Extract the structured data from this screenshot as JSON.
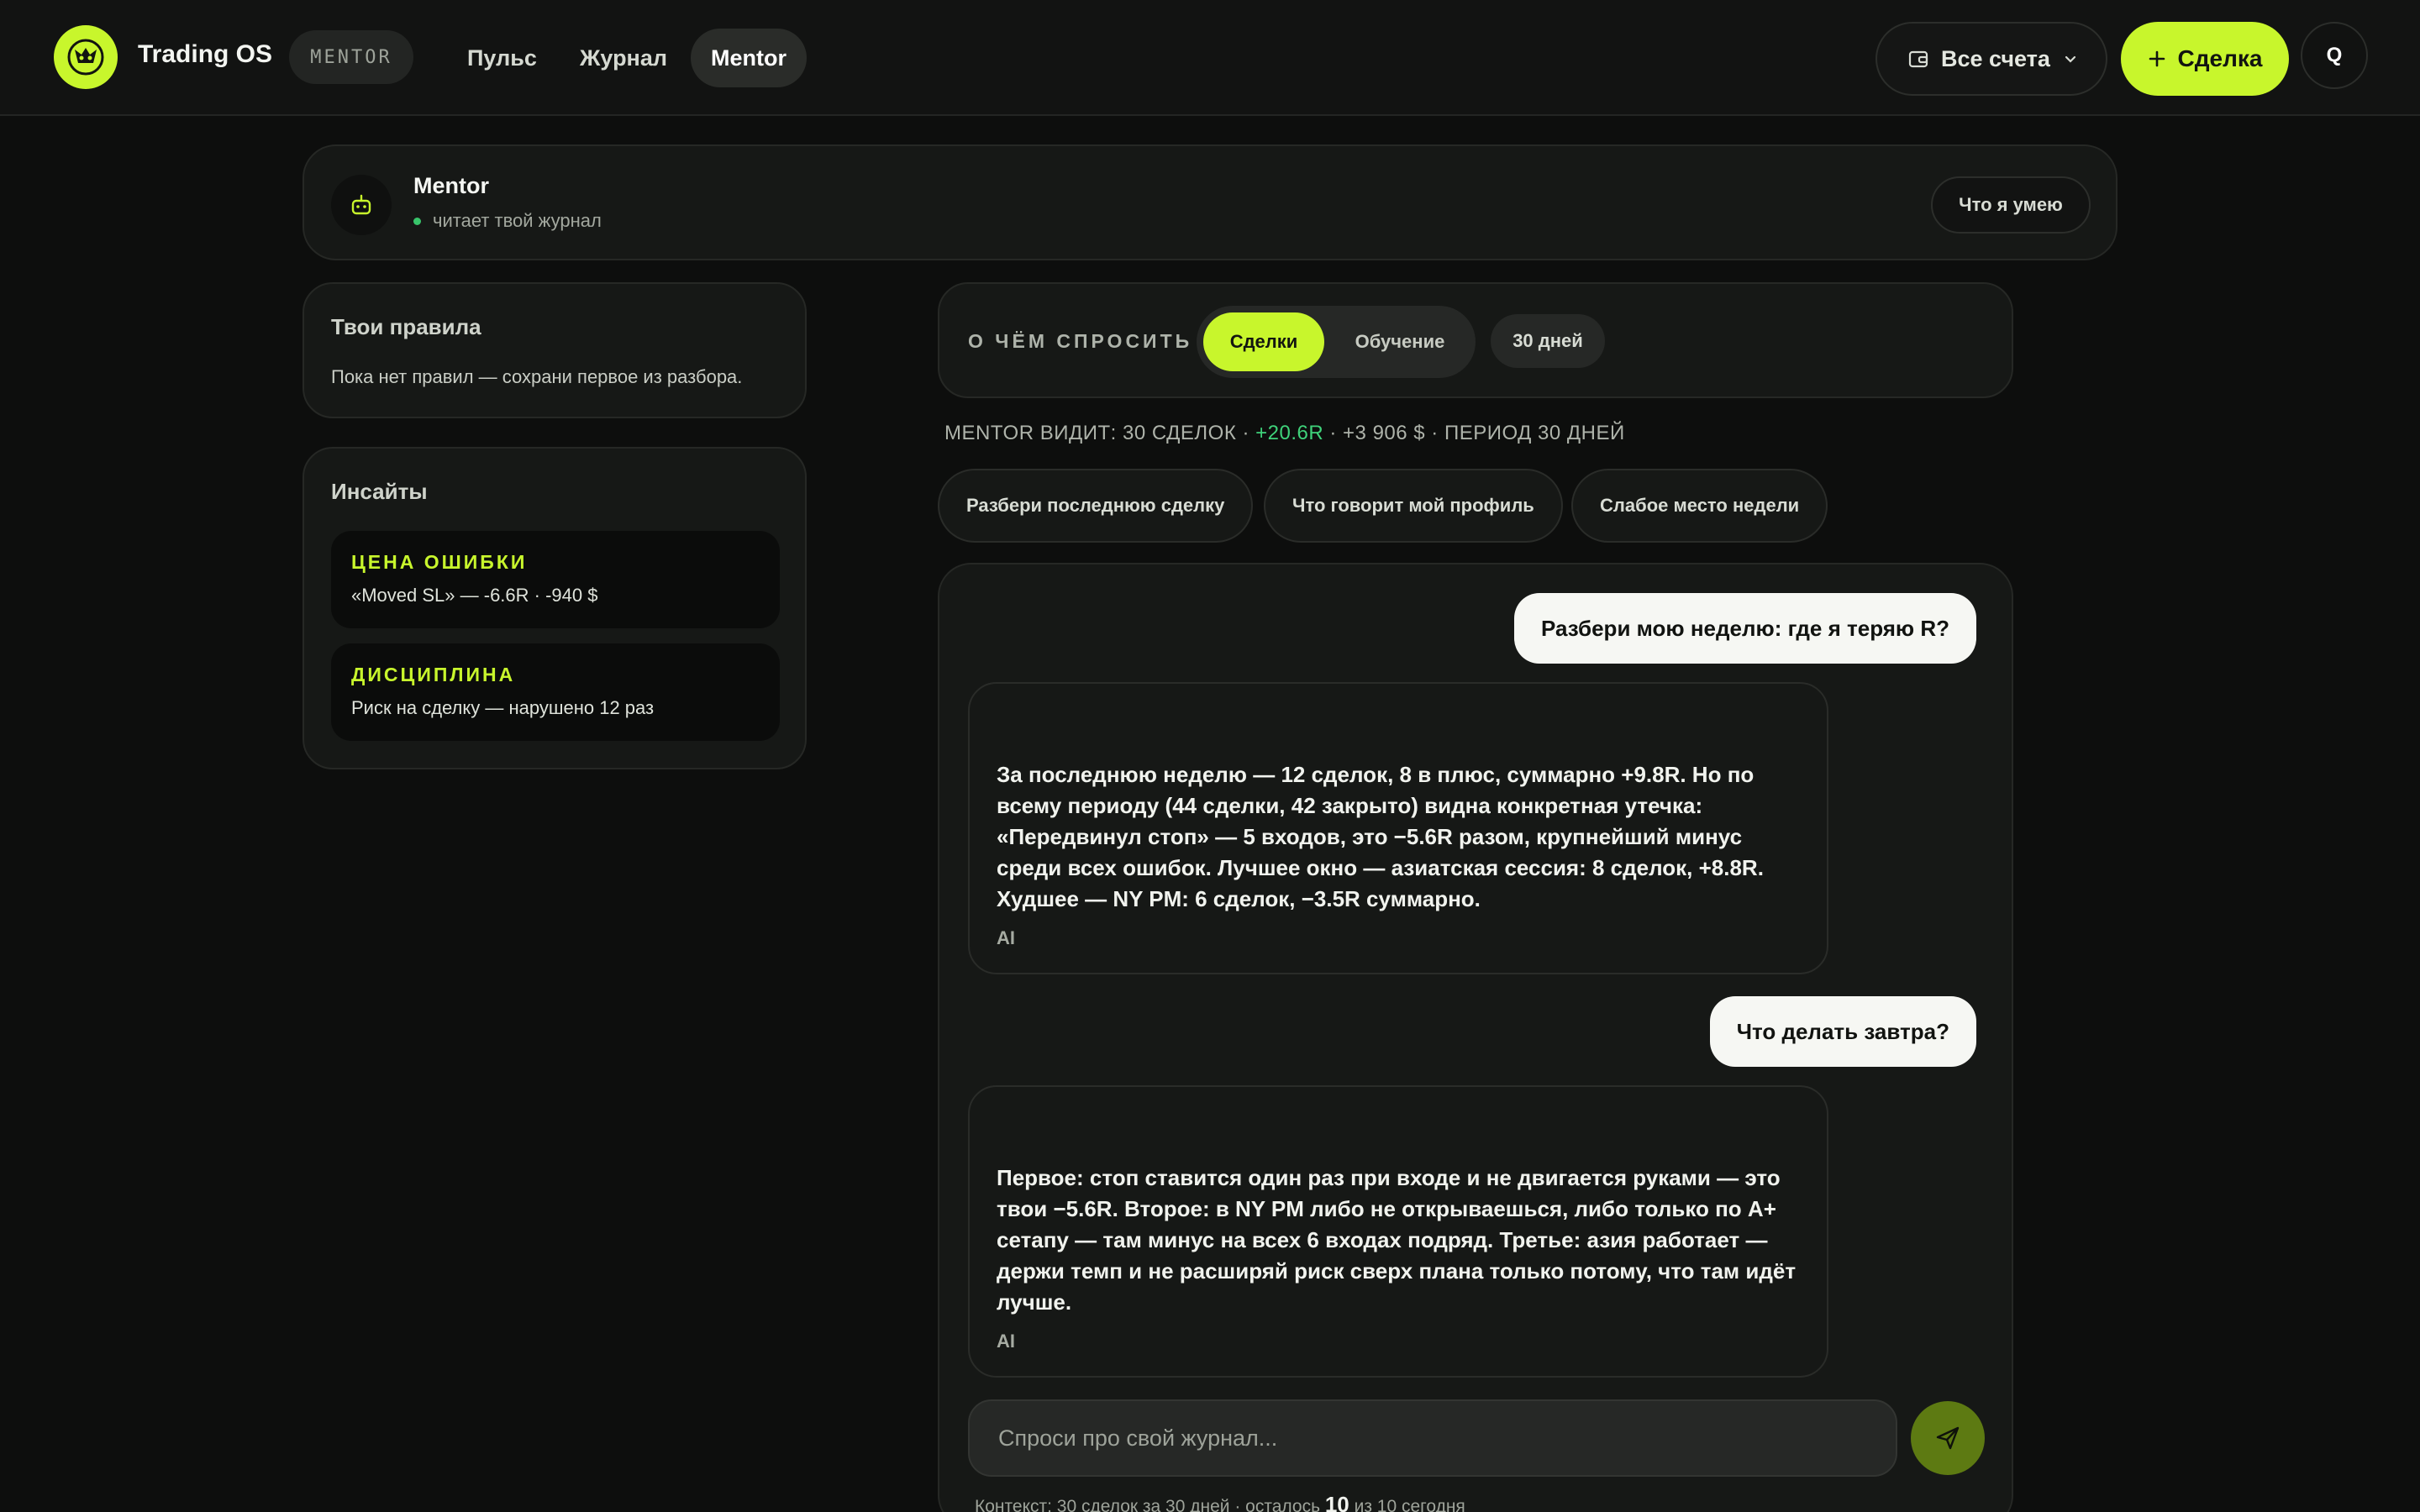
{
  "header": {
    "brand": "Trading OS",
    "mode_badge": "MENTOR",
    "nav": [
      {
        "label": "Пульс",
        "active": false
      },
      {
        "label": "Журнал",
        "active": false
      },
      {
        "label": "Mentor",
        "active": true
      }
    ],
    "accounts_label": "Все счета",
    "deal_button": "Сделка",
    "search_label": "Q"
  },
  "mentor": {
    "name": "Mentor",
    "status": "читает твой журнал",
    "capabilities_button": "Что я умею"
  },
  "rules": {
    "title": "Твои правила",
    "empty_text": "Пока нет правил — сохрани первое из разбора."
  },
  "insights": {
    "title": "Инсайты",
    "items": [
      {
        "heading": "ЦЕНА ОШИБКИ",
        "text": "«Moved SL» — -6.6R · -940 $"
      },
      {
        "heading": "ДИСЦИПЛИНА",
        "text": "Риск на сделку — нарушено 12 раз"
      }
    ]
  },
  "ask": {
    "label": "О ЧЁМ СПРОСИТЬ",
    "tabs": [
      {
        "label": "Сделки",
        "active": true
      },
      {
        "label": "Обучение",
        "active": false
      }
    ],
    "period": "30 дней"
  },
  "summary": {
    "prefix": "MENTOR ВИДИТ: 30 СДЕЛОК · ",
    "r_value": "+20.6R",
    "suffix": " · +3 906 $ · ПЕРИОД 30 ДНЕЙ"
  },
  "quick_prompts": [
    "Разбери последнюю сделку",
    "Что говорит мой профиль",
    "Слабое место недели"
  ],
  "chat": {
    "messages": [
      {
        "role": "user",
        "text": "Разбери мою неделю: где я теряю R?"
      },
      {
        "role": "ai",
        "text": "За последнюю неделю — 12 сделок, 8 в плюс, суммарно +9.8R. Но по всему периоду (44 сделки, 42 закрыто) видна конкретная утечка: «Передвинул стоп» — 5 входов, это −5.6R разом, крупнейший минус среди всех ошибок. Лучшее окно — азиатская сессия: 8 сделок, +8.8R. Худшее — NY PM: 6 сделок, −3.5R суммарно.",
        "tag": "AI"
      },
      {
        "role": "user",
        "text": "Что делать завтра?"
      },
      {
        "role": "ai",
        "text": "Первое: стоп ставится один раз при входе и не двигается руками — это твои −5.6R. Второе: в NY PM либо не открываешься, либо только по A+ сетапу — там минус на всех 6 входах подряд. Третье: азия работает — держи темп и не расширяй риск сверх плана только потому, что там идёт лучше.",
        "tag": "AI"
      }
    ],
    "input_placeholder": "Спроси про свой журнал...",
    "context_prefix": "Контекст: 30 сделок за 30 дней · осталось ",
    "context_remaining": "10",
    "context_suffix": " из 10 сегодня"
  },
  "colors": {
    "accent": "#c8f62c",
    "positive": "#3fd27a",
    "background": "#0d0e0d",
    "card": "#161816"
  }
}
